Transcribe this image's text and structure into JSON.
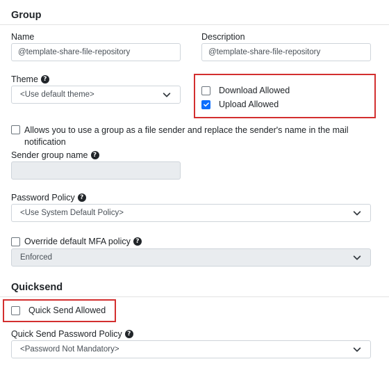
{
  "group": {
    "title": "Group",
    "name_label": "Name",
    "name_value": "@template-share-file-repository",
    "description_label": "Description",
    "description_value": "@template-share-file-repository",
    "theme_label": "Theme",
    "theme_value": "<Use default theme>",
    "download_allowed_label": "Download Allowed",
    "download_allowed_checked": false,
    "upload_allowed_label": "Upload Allowed",
    "upload_allowed_checked": true,
    "sender_checkbox_label_line1": "Allows you to use a group as a file sender and replace the sender's name in the mail",
    "sender_checkbox_label_line2": "notification",
    "sender_group_name_label": "Sender group name",
    "sender_group_name_value": "",
    "password_policy_label": "Password Policy",
    "password_policy_value": "<Use System Default Policy>",
    "override_mfa_label": "Override default MFA policy",
    "mfa_value": "Enforced"
  },
  "quicksend": {
    "title": "Quicksend",
    "quick_send_allowed_label": "Quick Send Allowed",
    "quick_send_allowed_checked": false,
    "password_policy_label": "Quick Send Password Policy",
    "password_policy_value": "<Password Not Mandatory>"
  },
  "colors": {
    "highlight": "#d32f2f",
    "checkbox_checked": "#0d6efd",
    "disabled_bg": "#e9ecef"
  }
}
